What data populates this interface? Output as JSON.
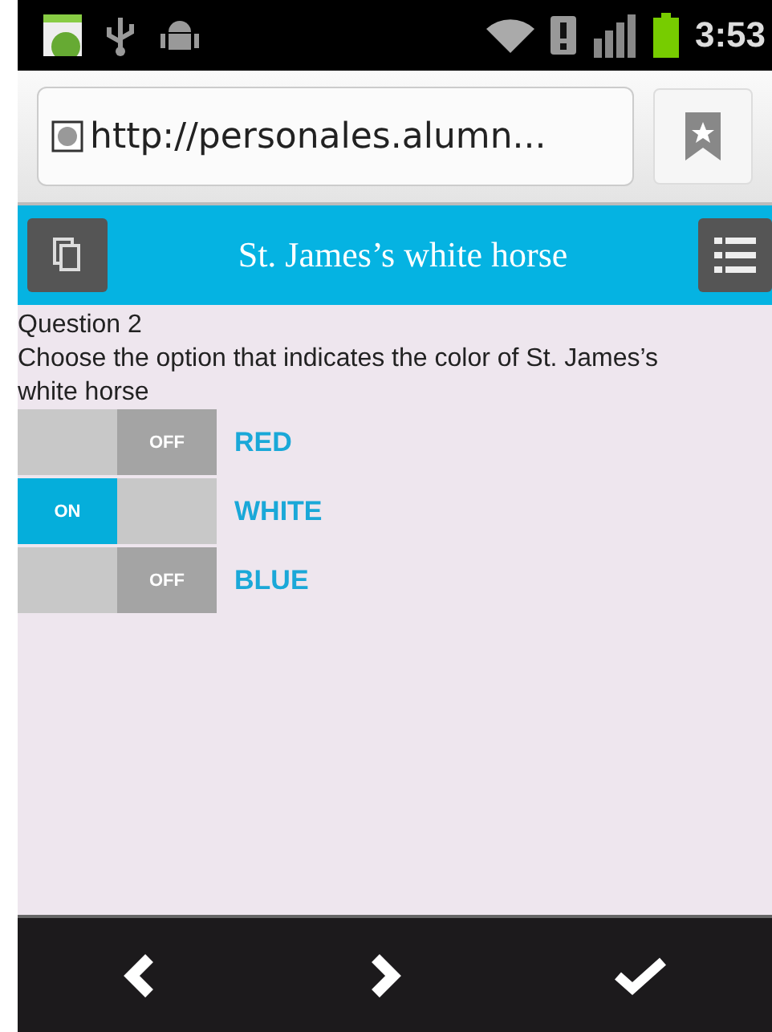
{
  "status_bar": {
    "time": "3:53"
  },
  "browser": {
    "url": "http://personales.alumn..."
  },
  "header": {
    "title": "St. James’s white horse"
  },
  "question": {
    "title": "Question 2",
    "text": "Choose the option that indicates the color of St. James’s white horse"
  },
  "options": [
    {
      "label": "RED",
      "switch_text": "OFF",
      "on": false
    },
    {
      "label": "WHITE",
      "switch_text": "ON",
      "on": true
    },
    {
      "label": "BLUE",
      "switch_text": "OFF",
      "on": false
    }
  ]
}
